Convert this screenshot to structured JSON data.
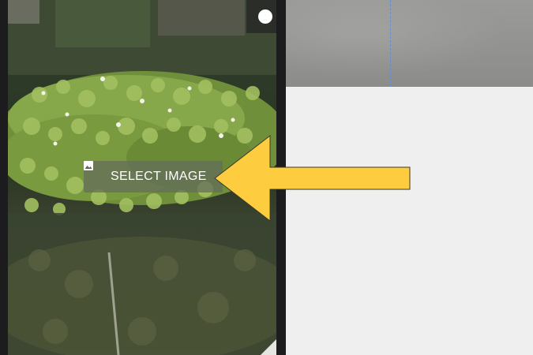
{
  "editor": {
    "select_image_label": "SELECT IMAGE",
    "close_icon": "close-icon",
    "select_image_icon": "image-icon"
  },
  "annotation": {
    "arrow_color": "#fecc3f",
    "arrow_outline": "#3a3a2a",
    "arrow_direction": "left"
  },
  "colors": {
    "panel_dark": "#1c1c1e",
    "canvas_background": "#efefef",
    "guide_line": "#5b8fd6"
  }
}
